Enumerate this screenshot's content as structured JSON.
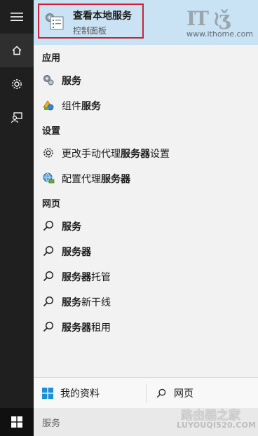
{
  "best_match": {
    "title_plain": "查看本地",
    "title_bold": "服务",
    "subtitle": "控制面板"
  },
  "watermark": {
    "it": "IT之家",
    "url": "www.ithome.com",
    "site": "路由器之家",
    "site_url": "LUYOUQI520.COM"
  },
  "sections": {
    "apps": "应用",
    "settings": "设置",
    "web": "网页"
  },
  "apps": [
    {
      "plain": "",
      "bold": "服务",
      "icon": "services-gear-icon"
    },
    {
      "plain": "组件",
      "bold": "服务",
      "icon": "component-services-icon"
    }
  ],
  "settings": [
    {
      "plain": "更改手动代理",
      "bold": "服务器",
      "suffix": "设置",
      "icon": "gear-icon"
    },
    {
      "plain": "配置代理",
      "bold": "服务器",
      "suffix": "",
      "icon": "network-globe-icon"
    }
  ],
  "web": [
    {
      "bold": "服务",
      "plain": ""
    },
    {
      "bold": "服务器",
      "plain": ""
    },
    {
      "bold": "服务器",
      "plain": "托管"
    },
    {
      "bold": "服务",
      "plain": "新干线"
    },
    {
      "bold": "服务器",
      "plain": "租用"
    }
  ],
  "bottom": {
    "my_stuff": "我的资料",
    "web": "网页"
  },
  "search": {
    "query": "服务"
  },
  "colors": {
    "rail": "#1f1f1f",
    "highlight": "#c9e3f5",
    "selection_border": "#d51e2b",
    "windows_blue": "#1a8ee0"
  }
}
